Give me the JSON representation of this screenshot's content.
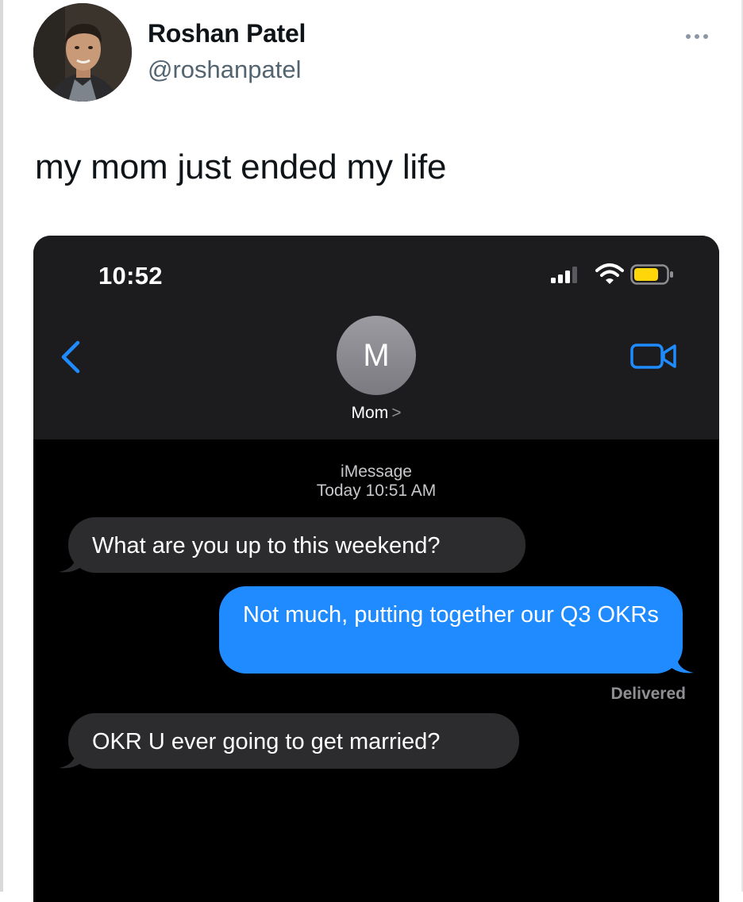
{
  "tweet": {
    "display_name": "Roshan Patel",
    "handle": "@roshanpatel",
    "text": "my mom just ended my life",
    "more_icon": "more-horizontal-icon"
  },
  "screenshot": {
    "status_bar": {
      "time": "10:52",
      "icons": [
        "signal-icon",
        "wifi-icon",
        "battery-icon"
      ],
      "battery_color": "#ffd60a"
    },
    "nav": {
      "back_icon": "chevron-left-icon",
      "video_icon": "facetime-video-icon",
      "contact_initial": "M",
      "contact_name": "Mom",
      "contact_chevron": ">"
    },
    "conversation": {
      "service": "iMessage",
      "timestamp": "Today 10:51 AM",
      "messages": [
        {
          "direction": "incoming",
          "text": "What are you up to this weekend?"
        },
        {
          "direction": "outgoing",
          "text": "Not much, putting together our Q3 OKRs"
        },
        {
          "direction": "incoming",
          "text": "OKR U ever going to get married?"
        }
      ],
      "delivery_status": "Delivered"
    },
    "colors": {
      "accent_blue": "#1f8bff",
      "incoming_bubble": "#2c2c2e",
      "header_bg": "#1c1c1e"
    }
  }
}
